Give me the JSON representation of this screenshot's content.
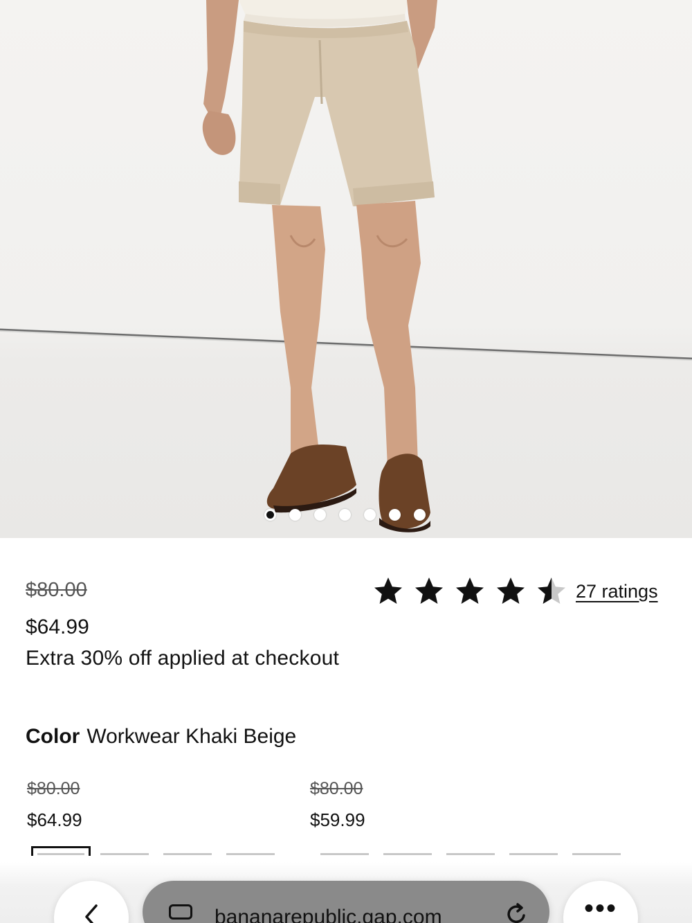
{
  "product": {
    "original_price": "$80.00",
    "sale_price": "$64.99",
    "promo": "Extra 30% off applied at checkout",
    "rating_value": 4.5,
    "rating_max": 5,
    "ratings_link": "27 ratings",
    "color_label": "Color",
    "color_value": "Workwear Khaki Beige"
  },
  "carousel": {
    "total_images": 7,
    "active_index": 0
  },
  "variants": [
    {
      "original": "$80.00",
      "price": "$64.99"
    },
    {
      "original": "$80.00",
      "price": "$59.99"
    }
  ],
  "browser": {
    "url": "bananarepublic.gap.com",
    "back_icon": "chevron-left-icon",
    "tabs_icon": "tabs-icon",
    "reload_icon": "reload-icon",
    "more_icon": "more-icon",
    "more_label": "•••"
  },
  "colors": {
    "star": "#111111",
    "star_empty": "#c8c8c8",
    "shorts": "#d8c8b0",
    "loafer": "#6b4226"
  }
}
